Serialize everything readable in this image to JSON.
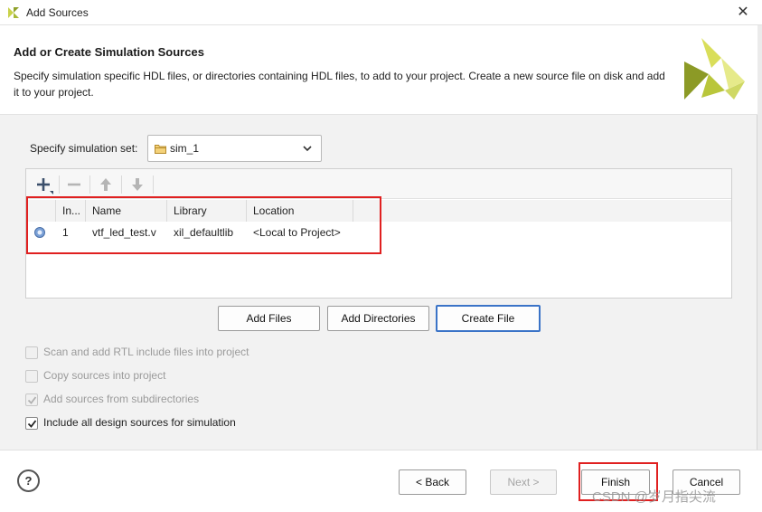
{
  "window": {
    "title": "Add Sources",
    "close_glyph": "✕"
  },
  "header": {
    "title": "Add or Create Simulation Sources",
    "description": "Specify simulation specific HDL files, or directories containing HDL files, to add to your project. Create a new source file on disk and add it to your project."
  },
  "simset": {
    "label": "Specify simulation set:",
    "value": "sim_1"
  },
  "table": {
    "columns": [
      "In...",
      "Name",
      "Library",
      "Location"
    ],
    "rows": [
      {
        "index": "1",
        "name": "vtf_led_test.v",
        "library": "xil_defaultlib",
        "location": "<Local to Project>"
      }
    ]
  },
  "actions": {
    "add_files": "Add Files",
    "add_directories": "Add Directories",
    "create_file": "Create File"
  },
  "options": [
    {
      "label": "Scan and add RTL include files into project",
      "checked": false,
      "enabled": false
    },
    {
      "label": "Copy sources into project",
      "checked": false,
      "enabled": false
    },
    {
      "label": "Add sources from subdirectories",
      "checked": true,
      "enabled": false
    },
    {
      "label": "Include all design sources for simulation",
      "checked": true,
      "enabled": true
    }
  ],
  "footer": {
    "help": "?",
    "back": "< Back",
    "next": "Next >",
    "finish": "Finish",
    "cancel": "Cancel"
  },
  "watermark": "CSDN @岁月指尖流",
  "colors": {
    "accent": "#3a73c7",
    "highlight": "#e02020",
    "brand": "#b7c93a"
  },
  "icons": [
    "xilinx-logo-icon",
    "close-icon",
    "folder-icon",
    "chevron-down-icon",
    "add-icon",
    "remove-icon",
    "move-up-icon",
    "move-down-icon",
    "verilog-file-icon",
    "help-icon"
  ]
}
